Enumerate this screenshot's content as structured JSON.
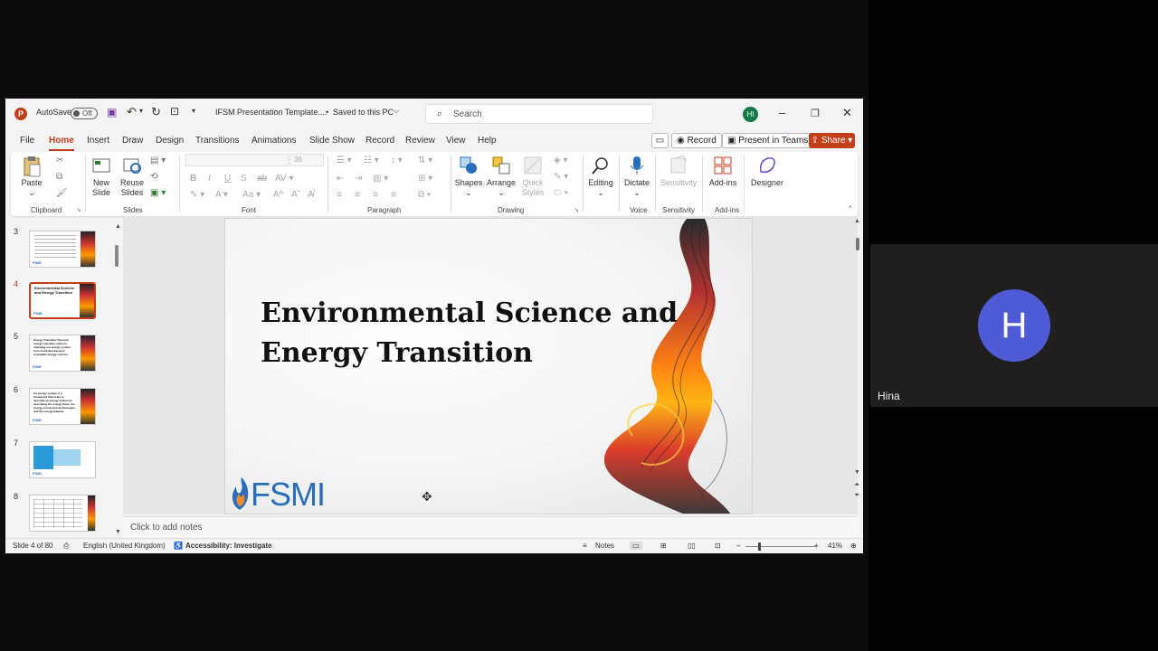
{
  "app": {
    "logo_letter": "P",
    "autosave_label": "AutoSave",
    "autosave_state": "Off",
    "file_title": "IFSM Presentation Template....",
    "save_status": "Saved to this PC",
    "search_placeholder": "Search",
    "user_initials": "HI"
  },
  "menu": {
    "tabs": [
      "File",
      "Home",
      "Insert",
      "Draw",
      "Design",
      "Transitions",
      "Animations",
      "Slide Show",
      "Record",
      "Review",
      "View",
      "Help"
    ],
    "active_tab": "Home",
    "record_label": "Record",
    "present_label": "Present in Teams",
    "share_label": "Share"
  },
  "ribbon": {
    "paste": "Paste",
    "new_slide_1": "New",
    "new_slide_2": "Slide",
    "reuse_1": "Reuse",
    "reuse_2": "Slides",
    "font_size": "36",
    "shapes": "Shapes",
    "arrange": "Arrange",
    "quick_1": "Quick",
    "quick_2": "Styles",
    "editing": "Editing",
    "dictate": "Dictate",
    "sensitivity_btn": "Sensitivity",
    "addins_btn": "Add-ins",
    "designer": "Designer",
    "groups": {
      "clipboard": "Clipboard",
      "slides": "Slides",
      "font": "Font",
      "paragraph": "Paragraph",
      "drawing": "Drawing",
      "voice": "Voice",
      "sensitivity": "Sensitivity",
      "addins": "Add-ins"
    }
  },
  "thumbnails": [
    {
      "num": "3",
      "text": ""
    },
    {
      "num": "4",
      "text": "Environmental Science and Energy Transition",
      "active": true
    },
    {
      "num": "5",
      "text": "Energy Transition The term energy transition refers to changing our energy system from fossil-fuel-based to renewable energy sources."
    },
    {
      "num": "6",
      "text": "An energy system is a framework that helps to describe an energy system by describing the energy flows, the energy conversion technologies and the energy balance."
    },
    {
      "num": "7",
      "text": ""
    },
    {
      "num": "8",
      "text": ""
    }
  ],
  "slide": {
    "title_line1": "Environmental Science and",
    "title_line2": "Energy Transition",
    "logo_text": "FSMI",
    "notes_placeholder": "Click to add notes"
  },
  "status": {
    "slide_counter": "Slide 4 of 80",
    "language": "English (United Kingdom)",
    "accessibility": "Accessibility: Investigate",
    "notes": "Notes",
    "zoom": "41%"
  },
  "participant": {
    "initial": "H",
    "name": "Hina",
    "avatar_color": "#4f5bd5"
  }
}
